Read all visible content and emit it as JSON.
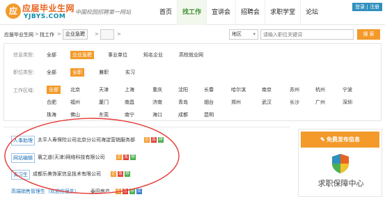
{
  "header": {
    "logo_cn": "应届毕业生网",
    "logo_en": "YJBYS.COM",
    "slogan": "中国校园招聘第一网站",
    "nav": [
      {
        "label": "首页",
        "active": false
      },
      {
        "label": "找工作",
        "active": true
      },
      {
        "label": "宣讲会",
        "active": false
      },
      {
        "label": "招聘会",
        "active": false
      },
      {
        "label": "求职学堂",
        "active": false
      },
      {
        "label": "论坛",
        "active": false
      }
    ],
    "login": "登录",
    "divider": "|",
    "register": "注册"
  },
  "breadcrumb": {
    "home": "应届毕业生网",
    "sep": ">",
    "find_job": "找工作",
    "current": "企业急聘",
    "empty_box": ""
  },
  "search": {
    "area_label": "地区",
    "area_arrow": "▾",
    "placeholder": "请输入职位关键词",
    "button": "搜 索"
  },
  "filters": {
    "info_type": {
      "label": "信息类型:",
      "options": [
        "全部",
        "企业急聘",
        "事业单位",
        "知名企业",
        "高校就业网"
      ],
      "selected": "企业急聘"
    },
    "job_type": {
      "label": "职位类型:",
      "options": [
        "全部",
        "全职",
        "兼职",
        "实习"
      ],
      "selected": "全职"
    },
    "region": {
      "label": "工作区域:",
      "row1": [
        "全部",
        "北京",
        "天津",
        "上海",
        "重庆",
        "沈阳",
        "长春",
        "哈尔滨",
        "南京",
        "苏州",
        "杭州",
        "宁波"
      ],
      "row2": [
        "合肥",
        "福州",
        "厦门",
        "南昌",
        "济南",
        "青岛",
        "烟台",
        "郑州",
        "武汉",
        "长沙",
        "广州",
        "深圳"
      ],
      "row3": [
        "珠海",
        "佛山",
        "东莞",
        "南宁",
        "海口",
        "成都",
        "昆明"
      ],
      "selected": "全部"
    }
  },
  "results": [
    {
      "title": "人事助理",
      "company": "太平人寿保险公司北京分公司海淀营销服务部",
      "tags": [
        "企",
        "急",
        "荐"
      ]
    },
    {
      "title": "网站编辑",
      "company": "寰之道(天津)网络科技有限公司",
      "tags": [
        "企",
        "急",
        "荐"
      ]
    },
    {
      "title": "实习生",
      "company": "成都乐美饰家信息技术有限公司",
      "tags": [
        "企",
        "急",
        "荐"
      ]
    },
    {
      "title": "高端销售管理生（欢迎应届生）",
      "company": "泰田房产",
      "tags": [
        "企",
        "急",
        "荐",
        "实"
      ]
    }
  ],
  "sidebar": {
    "publish_button": "免费发布信息",
    "guard_title": "求职保障中心"
  },
  "colors": {
    "accent": "#f39a2a",
    "nav_active": "#3b8f2f",
    "link": "#1a6fb3",
    "annotation": "#e53935"
  }
}
